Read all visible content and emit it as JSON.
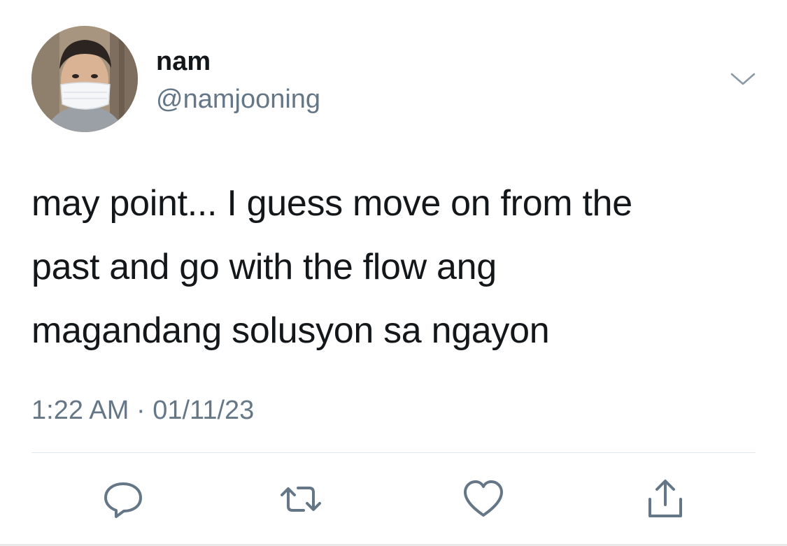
{
  "user": {
    "display_name": "nam",
    "handle": "@namjooning",
    "avatar_icon": "profile-photo-masked-person"
  },
  "tweet": {
    "text": "may point... I guess move on from the\npast and go with the flow ang\nmagandang solusyon sa ngayon",
    "timestamp": "1:22 AM · 01/11/23"
  },
  "actions": [
    {
      "icon": "reply-icon"
    },
    {
      "icon": "retweet-icon"
    },
    {
      "icon": "like-icon"
    },
    {
      "icon": "share-icon"
    }
  ],
  "menu_icon": "chevron-down-icon",
  "colors": {
    "primary_text": "#14171a",
    "secondary_text": "#657786",
    "icon": "#657786",
    "divider": "#e1e8ed"
  }
}
